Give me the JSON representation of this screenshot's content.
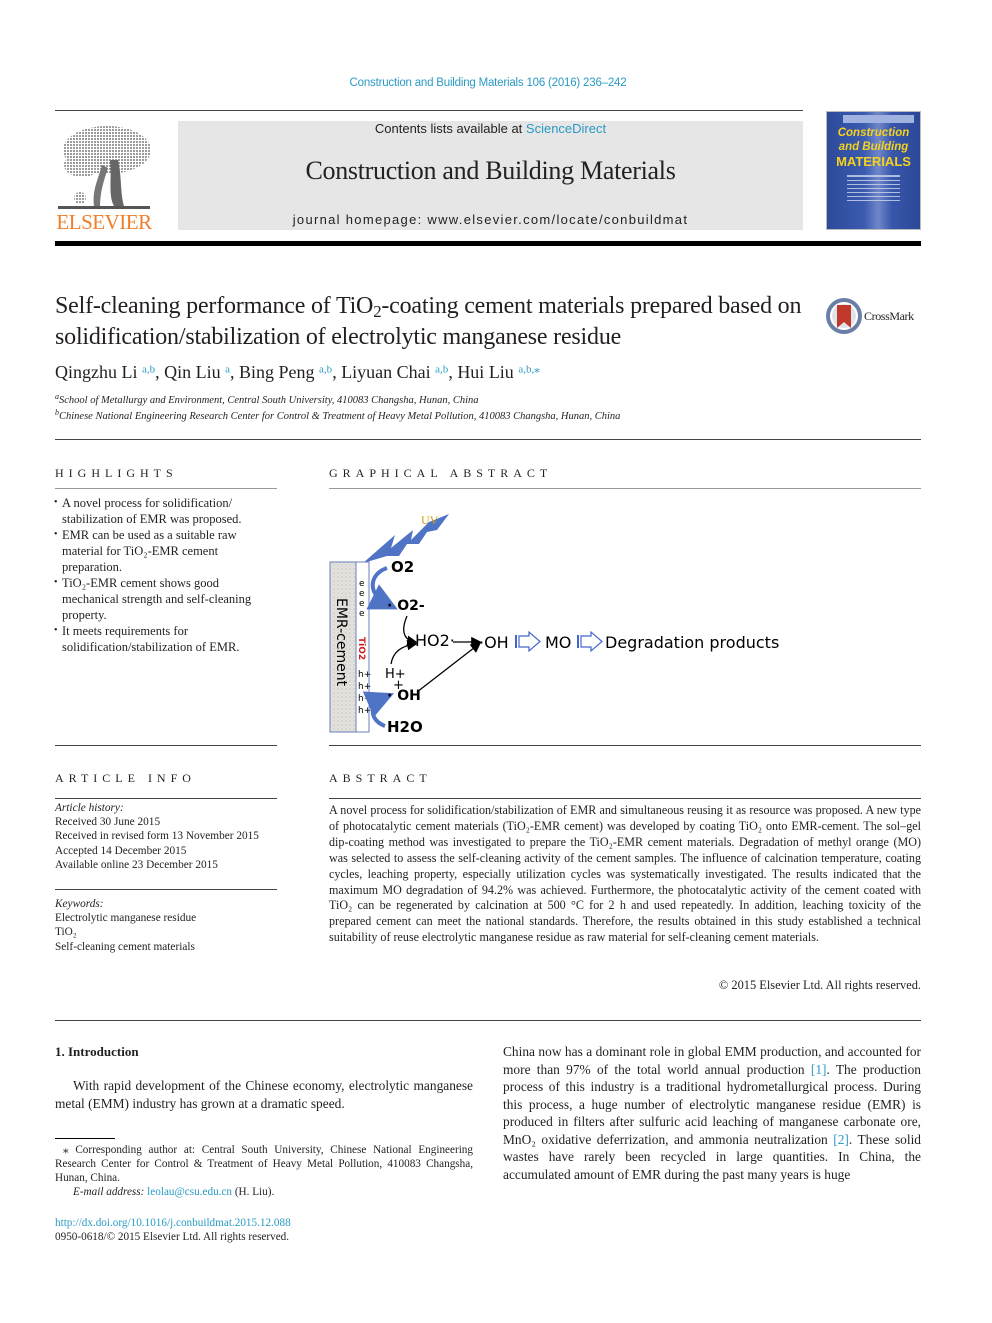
{
  "header": {
    "journal_ref": "Construction and Building Materials 106 (2016) 236–242",
    "contents_prefix": "Contents lists available at ",
    "contents_link": "ScienceDirect",
    "journal_title": "Construction and Building Materials",
    "homepage": "journal homepage: www.elsevier.com/locate/conbuildmat",
    "publisher_logo_text": "ELSEVIER",
    "cover": {
      "line1": "Construction",
      "line2": "and Building",
      "line3": "MATERIALS"
    }
  },
  "article": {
    "title_part1": "Self-cleaning performance of TiO",
    "title_sub": "2",
    "title_part2": "-coating cement materials prepared based on solidification/stabilization of electrolytic manganese residue",
    "crossmark_label": "CrossMark",
    "authors": [
      {
        "name": "Qingzhu Li",
        "affil": "a,b"
      },
      {
        "name": "Qin Liu",
        "affil": "a"
      },
      {
        "name": "Bing Peng",
        "affil": "a,b"
      },
      {
        "name": "Liyuan Chai",
        "affil": "a,b"
      },
      {
        "name": "Hui Liu",
        "affil": "a,b,⁎"
      }
    ],
    "affiliations": [
      {
        "key": "a",
        "text": "School of Metallurgy and Environment, Central South University, 410083 Changsha, Hunan, China"
      },
      {
        "key": "b",
        "text": "Chinese National Engineering Research Center for Control & Treatment of Heavy Metal Pollution, 410083 Changsha, Hunan, China"
      }
    ]
  },
  "highlights": {
    "heading": "HIGHLIGHTS",
    "items": [
      "A novel process for solidification/ stabilization of EMR was proposed.",
      "EMR can be used as a suitable raw material for TiO₂-EMR cement preparation.",
      "TiO₂-EMR cement shows good mechanical strength and self-cleaning property.",
      "It meets requirements for solidification/stabilization of EMR."
    ]
  },
  "graphical_abstract": {
    "heading": "GRAPHICAL ABSTRACT",
    "labels": {
      "uv": "UV",
      "substrate": "EMR-cement",
      "coating": "TiO2",
      "o2": "O2",
      "superoxide": "· O2-",
      "ho2": "HO2·",
      "oh_radical": "·OH",
      "mo": "MO",
      "products": "Degradation products",
      "h_plus": "H+",
      "plus": "+",
      "oh_bottom": "· OH",
      "h2o": "H2O",
      "electron": "e",
      "hole": "h+"
    },
    "colors": {
      "uv_bolt": "#4f74c6",
      "uv_text": "#d4a017",
      "coating_text": "#d01c1c",
      "curve_arrow": "#4f74c6",
      "block_arrow": "#4466cc"
    }
  },
  "article_info": {
    "heading": "ARTICLE INFO",
    "history_label": "Article history:",
    "history": [
      "Received 30 June 2015",
      "Received in revised form 13 November 2015",
      "Accepted 14 December 2015",
      "Available online 23 December 2015"
    ],
    "keywords_label": "Keywords:",
    "keywords": [
      "Electrolytic manganese residue",
      "TiO₂",
      "Self-cleaning cement materials"
    ]
  },
  "abstract": {
    "heading": "ABSTRACT",
    "text": "A novel process for solidification/stabilization of EMR and simultaneous reusing it as resource was proposed. A new type of photocatalytic cement materials (TiO₂-EMR cement) was developed by coating TiO₂ onto EMR-cement. The sol–gel dip-coating method was investigated to prepare the TiO₂-EMR cement materials. Degradation of methyl orange (MO) was selected to assess the self-cleaning activity of the cement samples. The influence of calcination temperature, coating cycles, leaching property, especially utilization cycles was systematically investigated. The results indicated that the maximum MO degradation of 94.2% was achieved. Furthermore, the photocatalytic activity of the cement coated with TiO₂ can be regenerated by calcination at 500 °C for 2 h and used repeatedly. In addition, leaching toxicity of the prepared cement can meet the national standards. Therefore, the results obtained in this study established a technical suitability of reuse electrolytic manganese residue as raw material for self-cleaning cement materials.",
    "copyright": "© 2015 Elsevier Ltd. All rights reserved."
  },
  "introduction": {
    "heading": "1. Introduction",
    "left_text": "With rapid development of the Chinese economy, electrolytic manganese metal (EMM) industry has grown at a dramatic speed.",
    "right_part1": "China now has a dominant role in global EMM production, and accounted for more than 97% of the total world annual production ",
    "ref1": "[1]",
    "right_part2": ". The production process of this industry is a traditional hydrometallurgical process. During this process, a huge number of electrolytic manganese residue (EMR) is produced in filters after sulfuric acid leaching of manganese carbonate ore, MnO₂ oxidative deferrization, and ammonia neutralization ",
    "ref2": "[2]",
    "right_part3": ". These solid wastes have rarely been recycled in large quantities. In China, the accumulated amount of EMR during the past many years is huge"
  },
  "footnote": {
    "corresponding": "⁎ Corresponding author at: Central South University, Chinese National Engineering Research Center for Control & Treatment of Heavy Metal Pollution, 410083 Changsha, Hunan, China.",
    "email_label": "E-mail address: ",
    "email": "leolau@csu.edu.cn",
    "email_suffix": " (H. Liu).",
    "doi": "http://dx.doi.org/10.1016/j.conbuildmat.2015.12.088",
    "issn": "0950-0618/© 2015 Elsevier Ltd. All rights reserved."
  }
}
